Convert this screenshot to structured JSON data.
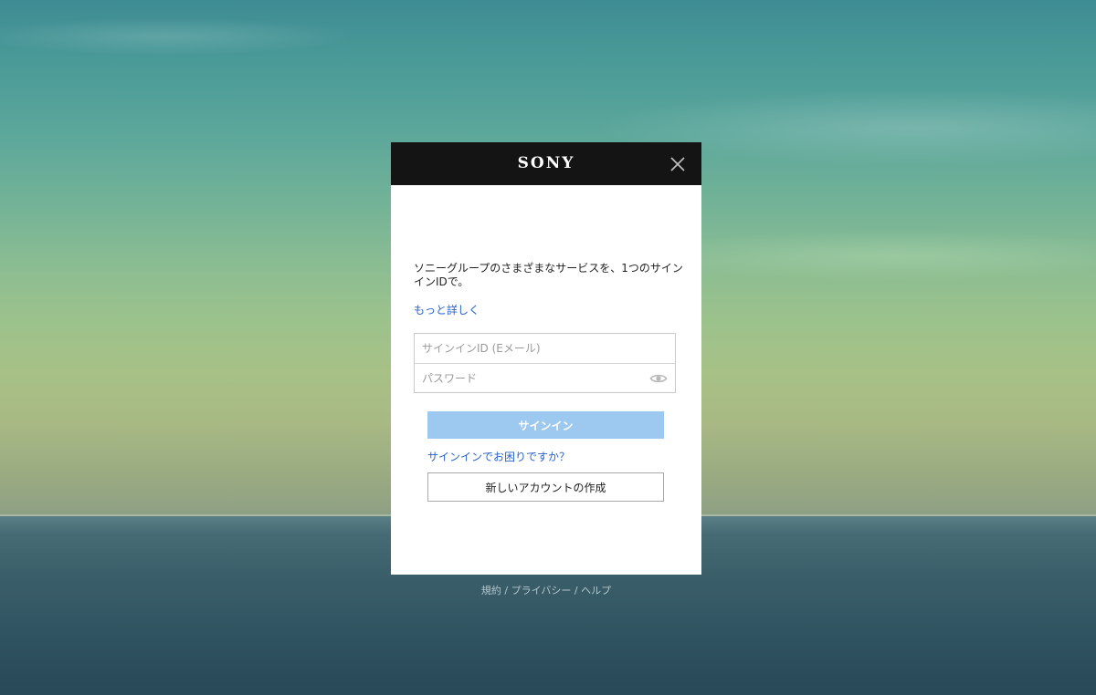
{
  "header": {
    "brand": "SONY",
    "close_icon": "close-icon"
  },
  "intro": {
    "description": "ソニーグループのさまざまなサービスを、1つのサインインIDで。",
    "learn_more": "もっと詳しく"
  },
  "form": {
    "signin_id": {
      "placeholder": "サインインID (Eメール)",
      "value": ""
    },
    "password": {
      "placeholder": "パスワード",
      "value": "",
      "toggle_icon": "eye-icon"
    },
    "signin_button": "サインイン",
    "signin_help": "サインインでお困りですか？",
    "create_account_button": "新しいアカウントの作成"
  },
  "footer": {
    "terms": "規約",
    "privacy": "プライバシー",
    "help": "ヘルプ",
    "separator": " / "
  },
  "colors": {
    "header_bg": "#141414",
    "link": "#2b63c9",
    "signin_button_bg": "#9dc8ef"
  }
}
